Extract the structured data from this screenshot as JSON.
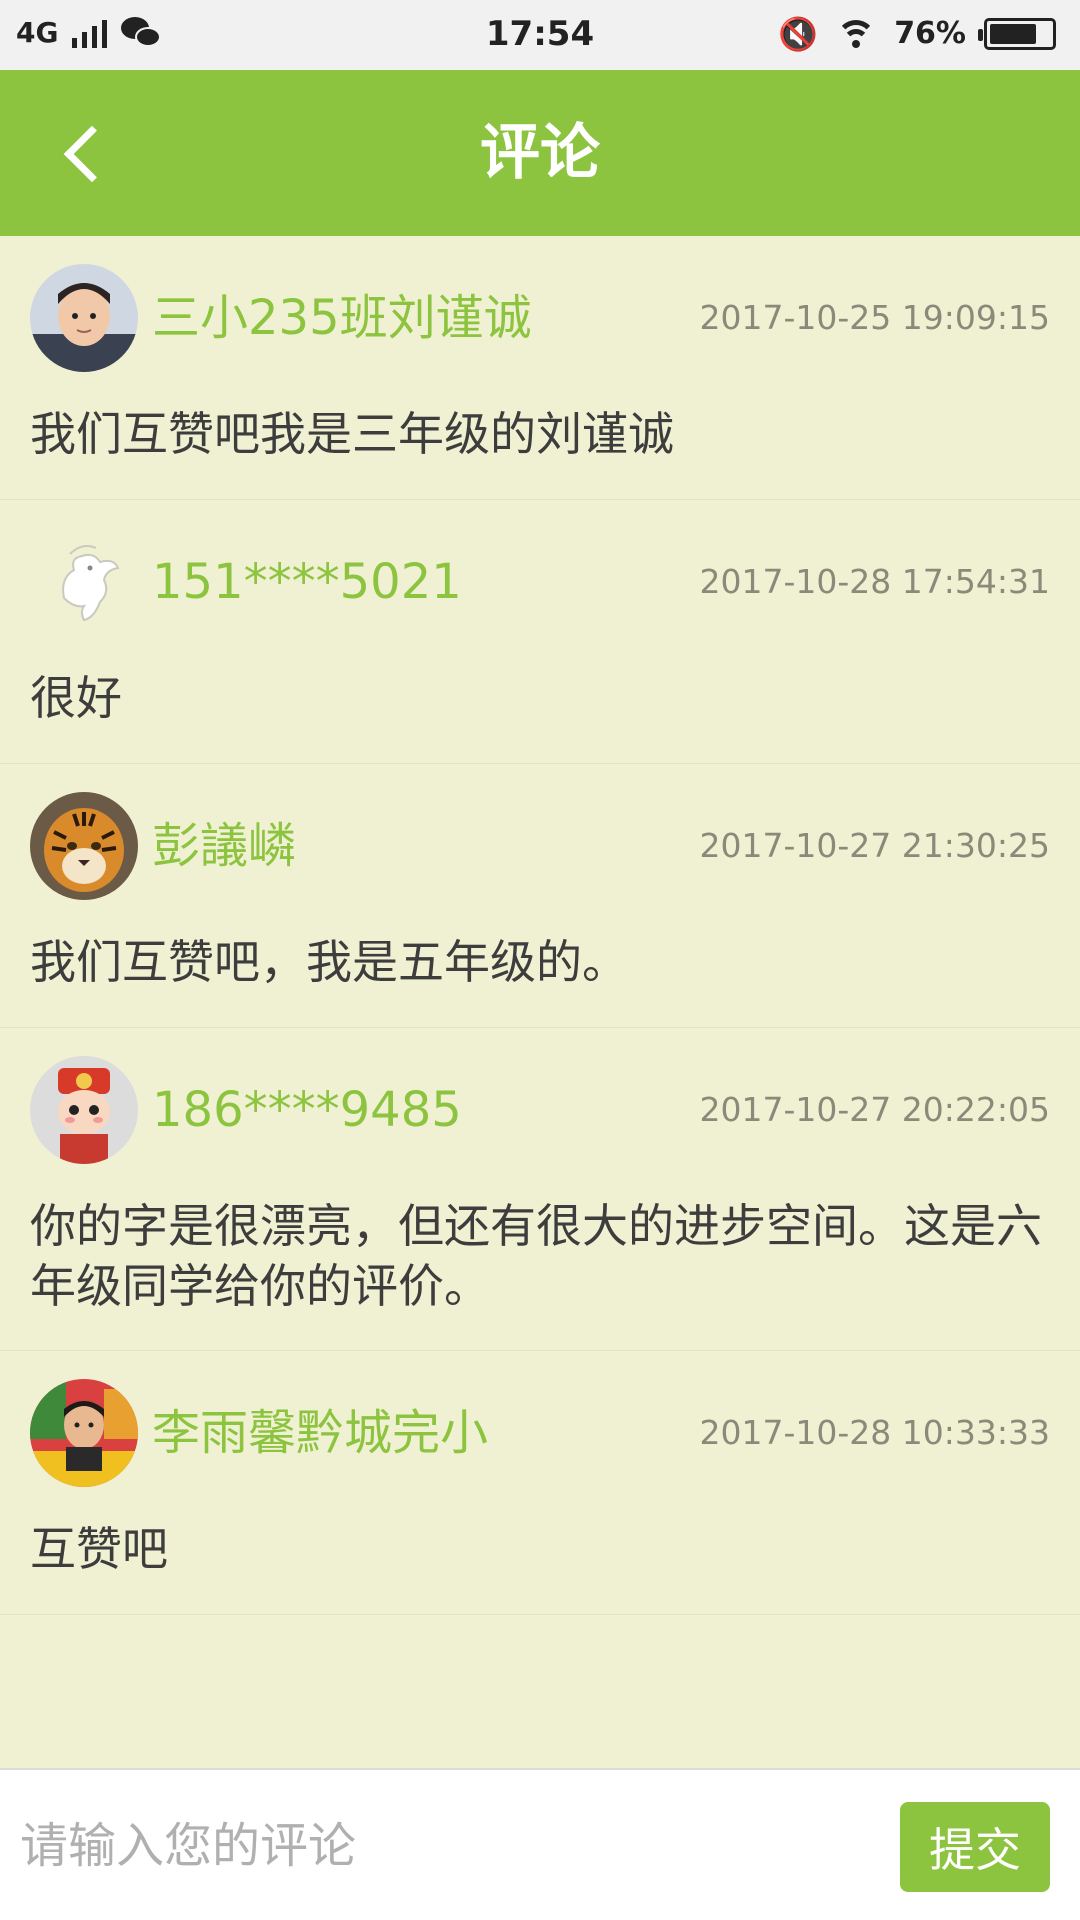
{
  "status_bar": {
    "network": "4G",
    "time": "17:54",
    "battery": "76%",
    "battery_level": 0.76,
    "icons": [
      "signal-icon",
      "wechat-icon",
      "mute-icon",
      "wifi-icon",
      "battery-icon"
    ]
  },
  "header": {
    "title": "评论",
    "back_icon": "chevron-left-icon"
  },
  "comments": [
    {
      "username": "三小235班刘谨诚",
      "timestamp": "2017-10-25 19:09:15",
      "content": "我们互赞吧我是三年级的刘谨诚",
      "avatar": "child-photo-avatar"
    },
    {
      "username": "151****5021",
      "timestamp": "2017-10-28 17:54:31",
      "content": "很好",
      "avatar": "default-dragon-avatar"
    },
    {
      "username": "彭議嶙",
      "timestamp": "2017-10-27 21:30:25",
      "content": "我们互赞吧，我是五年级的。",
      "avatar": "tiger-avatar"
    },
    {
      "username": "186****9485",
      "timestamp": "2017-10-27 20:22:05",
      "content": "你的字是很漂亮，但还有很大的进步空间。这是六年级同学给你的评价。",
      "avatar": "cartoon-avatar"
    },
    {
      "username": "李雨馨黔城完小",
      "timestamp": "2017-10-28 10:33:33",
      "content": "互赞吧",
      "avatar": "child-photo-avatar"
    }
  ],
  "input": {
    "placeholder": "请输入您的评论",
    "value": "",
    "submit_label": "提交"
  },
  "colors": {
    "accent": "#8dc43f",
    "background": "#f0f0d2",
    "text": "#3d3d3d",
    "timestamp": "#8a8a7a"
  }
}
